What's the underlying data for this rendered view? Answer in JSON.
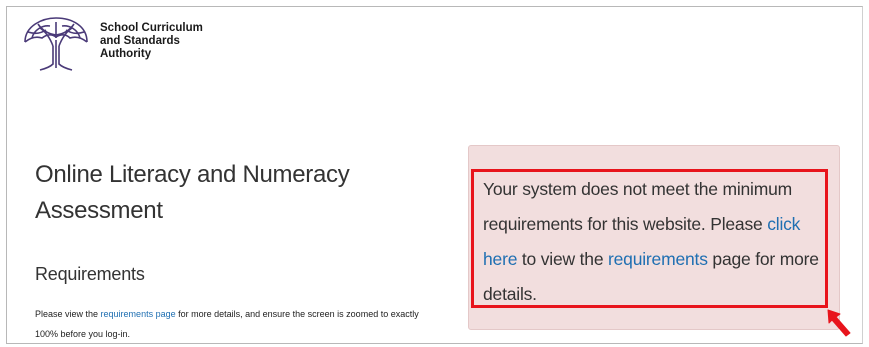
{
  "header": {
    "org_name_line1": "School Curriculum",
    "org_name_line2": "and Standards",
    "org_name_line3": "Authority"
  },
  "main": {
    "title": "Online Literacy and Numeracy Assessment",
    "requirements_heading": "Requirements",
    "requirements_text_before": "Please view the ",
    "requirements_link": "requirements page",
    "requirements_text_after": " for more details, and ensure the screen is zoomed to exactly 100% before you log-in."
  },
  "alert": {
    "text_part1": "Your system does not meet the minimum requirements for this website. Please ",
    "link_click_here": "click here",
    "text_part2": " to view the ",
    "link_requirements": "requirements",
    "text_part3": " page for more details."
  },
  "colors": {
    "alert_background": "#f2dede",
    "highlight_border": "#e8141c",
    "link": "#1f6fb2"
  }
}
